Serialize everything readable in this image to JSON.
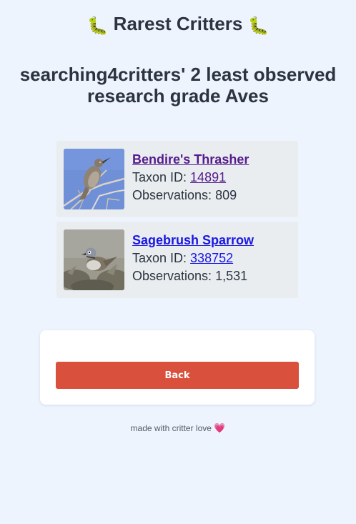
{
  "header": {
    "emoji": "🐛",
    "title": "Rarest Critters"
  },
  "heading": {
    "line1": "searching4critters' 2 least observed",
    "line2": "research grade Aves"
  },
  "results": [
    {
      "name": "Bendire's Thrasher",
      "taxon_label": "Taxon ID: ",
      "taxon_id": "14891",
      "observations_label": "Observations: ",
      "observations": "809"
    },
    {
      "name": "Sagebrush Sparrow",
      "taxon_label": "Taxon ID: ",
      "taxon_id": "338752",
      "observations_label": "Observations: ",
      "observations": "1,531"
    }
  ],
  "panel": {
    "back_label": "Back"
  },
  "footer": {
    "text": "made with critter love ",
    "heart": "💗"
  },
  "colors": {
    "background": "#eef4fe",
    "card": "#e9edf0",
    "link": "#1a16e3",
    "visited_link": "#551a8b",
    "back_button": "#d9513c"
  }
}
